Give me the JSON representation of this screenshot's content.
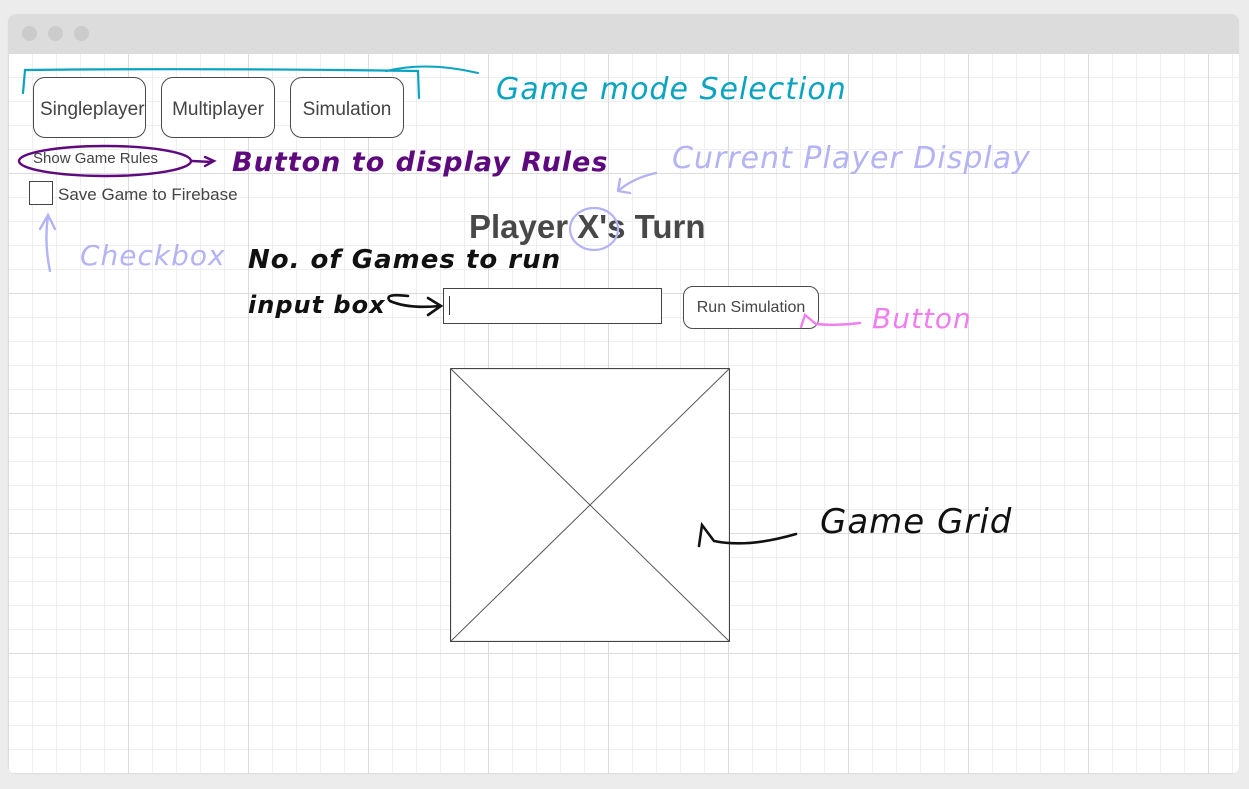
{
  "window": {
    "titlebar_dots": [
      "close",
      "minimize",
      "maximize"
    ]
  },
  "game_modes": [
    {
      "label": "Singleplayer"
    },
    {
      "label": "Multiplayer"
    },
    {
      "label": "Simulation"
    }
  ],
  "rules_button": {
    "label": "Show Game Rules"
  },
  "save_option": {
    "label": "Save Game to Firebase",
    "checked": false
  },
  "turn_display": {
    "text": "Player X's Turn",
    "current_player": "X"
  },
  "simulation": {
    "games_input_value": "",
    "games_input_placeholder": "",
    "run_button_label": "Run Simulation"
  },
  "game_grid": {
    "placeholder": "image-placeholder-x"
  },
  "annotations": {
    "game_mode": {
      "text": "Game mode Selection",
      "color": "#0aa3c2"
    },
    "rules": {
      "text": "Button to display Rules",
      "color": "#5e0a7e"
    },
    "player": {
      "text": "Current Player Display",
      "color": "#b3b3f5"
    },
    "checkbox": {
      "text": "Checkbox",
      "color": "#b3b3f5"
    },
    "games_count_line1": {
      "text": "No. of Games to run",
      "color": "#111111"
    },
    "games_count_line2": {
      "text": "input box",
      "color": "#111111"
    },
    "button": {
      "text": "Button",
      "color": "#f27cf0"
    },
    "grid": {
      "text": "Game Grid",
      "color": "#111111"
    }
  }
}
